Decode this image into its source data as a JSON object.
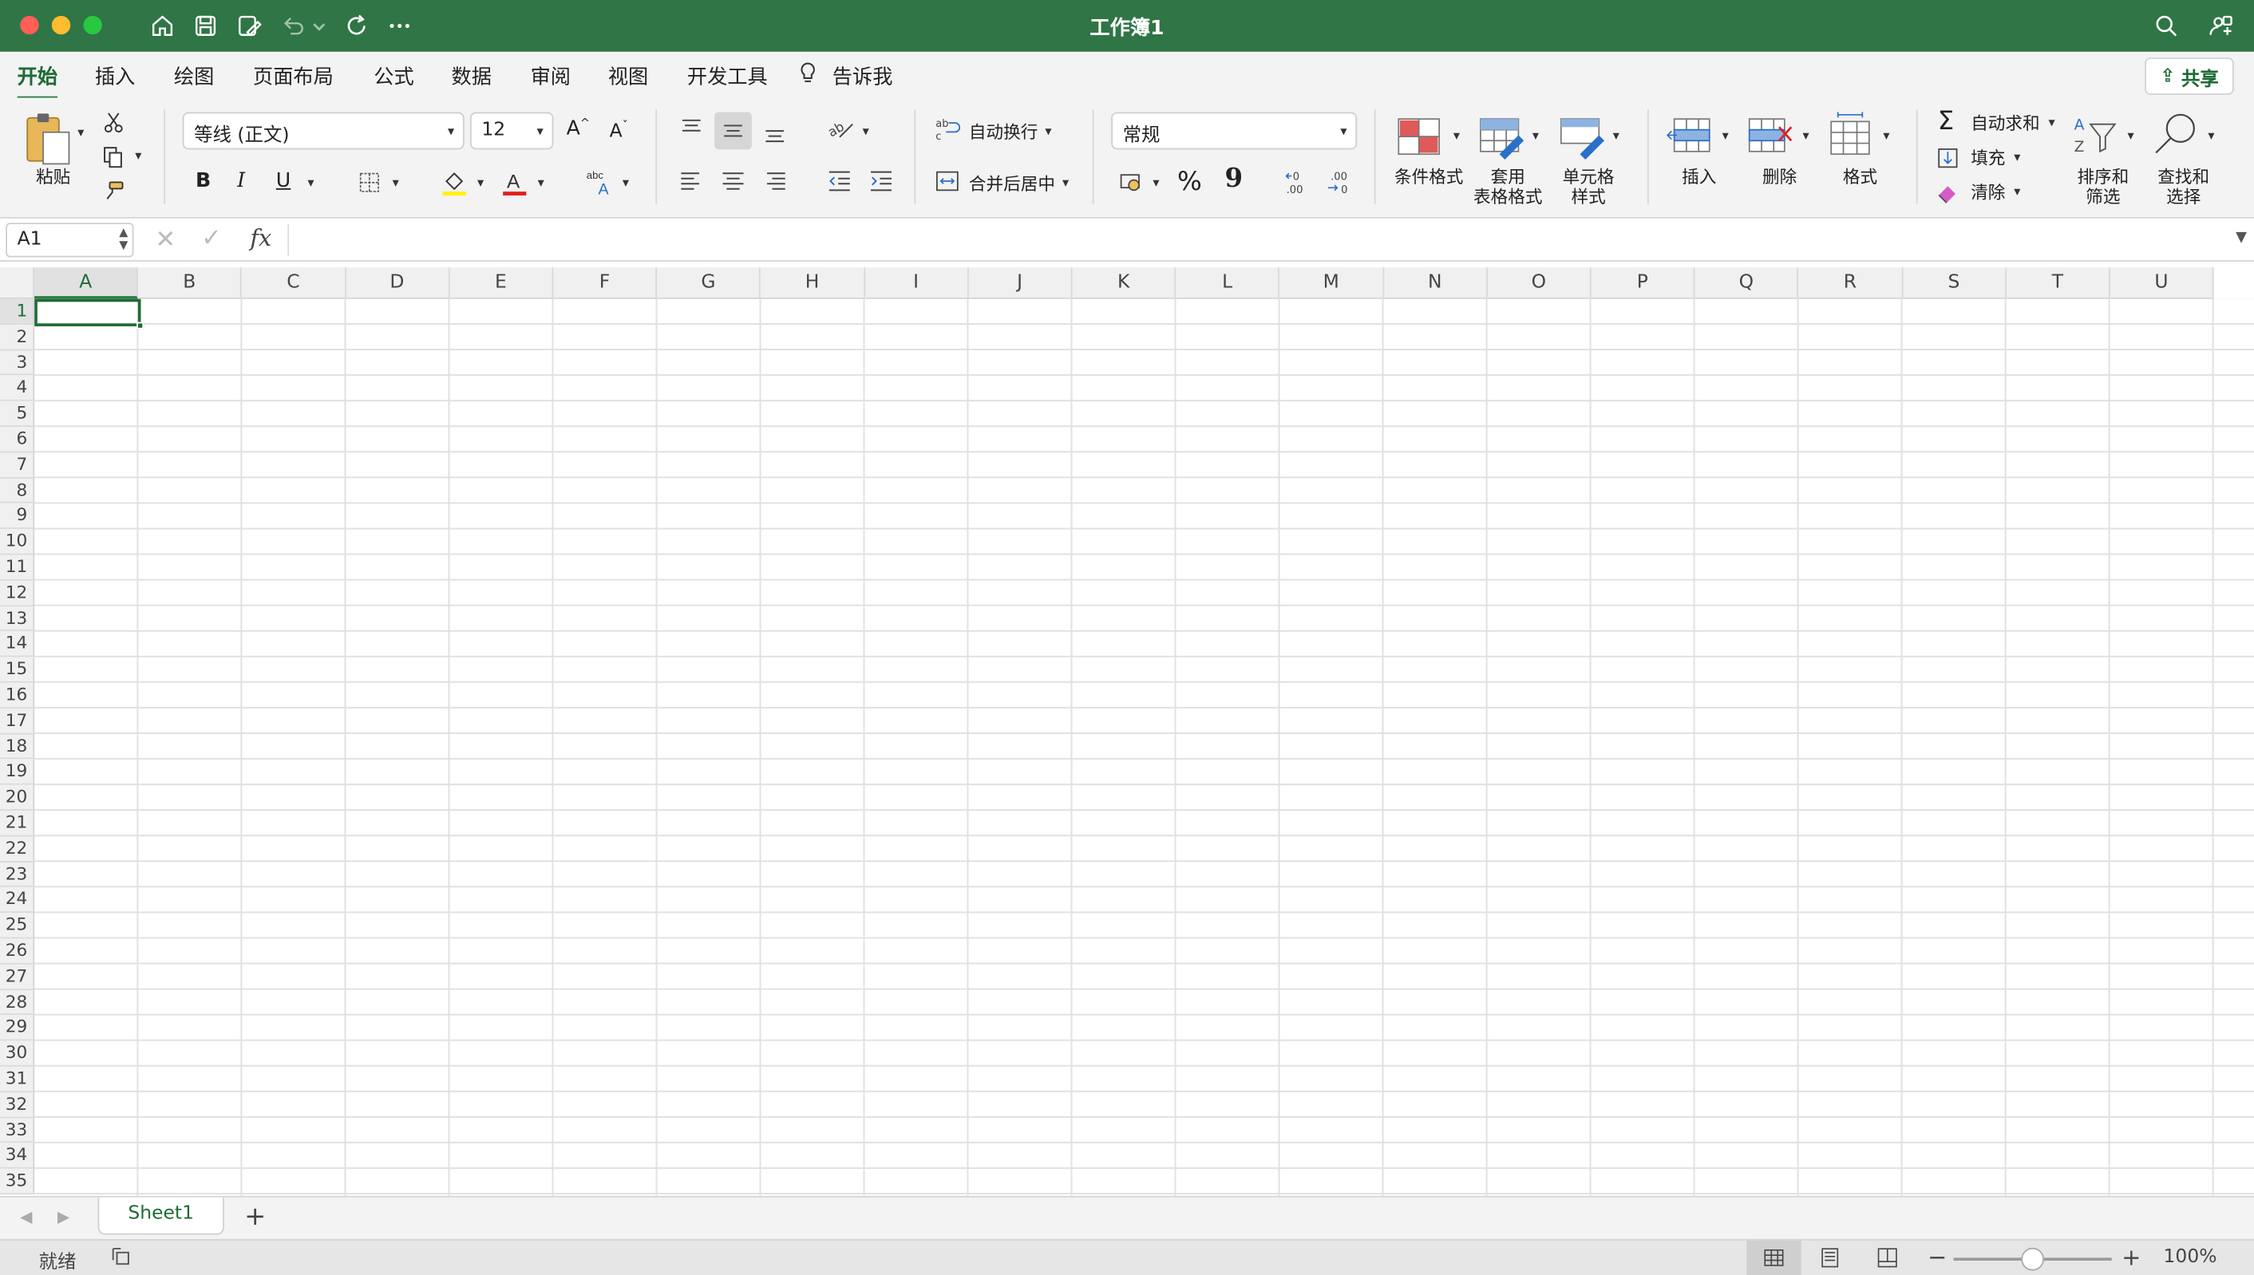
{
  "window": {
    "title": "工作簿1"
  },
  "ribbon_tabs": [
    "开始",
    "插入",
    "绘图",
    "页面布局",
    "公式",
    "数据",
    "审阅",
    "视图",
    "开发工具",
    "告诉我"
  ],
  "share_label": "共享",
  "clipboard": {
    "paste_label": "粘贴"
  },
  "font": {
    "name": "等线 (正文)",
    "size": "12"
  },
  "alignment": {
    "wrap_label": "自动换行",
    "merge_label": "合并后居中"
  },
  "number": {
    "format": "常规",
    "percent_symbol": "%",
    "comma_symbol": "9"
  },
  "styles": {
    "conditional": "条件格式",
    "table_line1": "套用",
    "table_line2": "表格格式",
    "cell_line1": "单元格",
    "cell_line2": "样式"
  },
  "cells": {
    "insert": "插入",
    "delete": "删除",
    "format": "格式"
  },
  "editing": {
    "autosum": "自动求和",
    "fill": "填充",
    "clear": "清除",
    "sort_line1": "排序和",
    "sort_line2": "筛选",
    "find_line1": "查找和",
    "find_line2": "选择"
  },
  "formula_bar": {
    "name_box": "A1",
    "fx": "fx",
    "formula": ""
  },
  "columns": [
    "A",
    "B",
    "C",
    "D",
    "E",
    "F",
    "G",
    "H",
    "I",
    "J",
    "K",
    "L",
    "M",
    "N",
    "O",
    "P",
    "Q",
    "R",
    "S",
    "T",
    "U"
  ],
  "rows": [
    "1",
    "2",
    "3",
    "4",
    "5",
    "6",
    "7",
    "8",
    "9",
    "10",
    "11",
    "12",
    "13",
    "14",
    "15",
    "16",
    "17",
    "18",
    "19",
    "20",
    "21",
    "22",
    "23",
    "24",
    "25",
    "26",
    "27",
    "28",
    "29",
    "30",
    "31",
    "32",
    "33",
    "34",
    "35"
  ],
  "selected_cell": "A1",
  "sheets": [
    "Sheet1"
  ],
  "status": {
    "mode": "就绪",
    "zoom": "100%",
    "zoom_value": 1.0
  },
  "colors": {
    "titlebar": "#307545",
    "accent": "#1e6b36"
  },
  "icons": [
    "home-icon",
    "save-icon",
    "save-as-icon",
    "undo-icon",
    "redo-icon",
    "more-icon",
    "search-icon",
    "share-person-icon"
  ]
}
